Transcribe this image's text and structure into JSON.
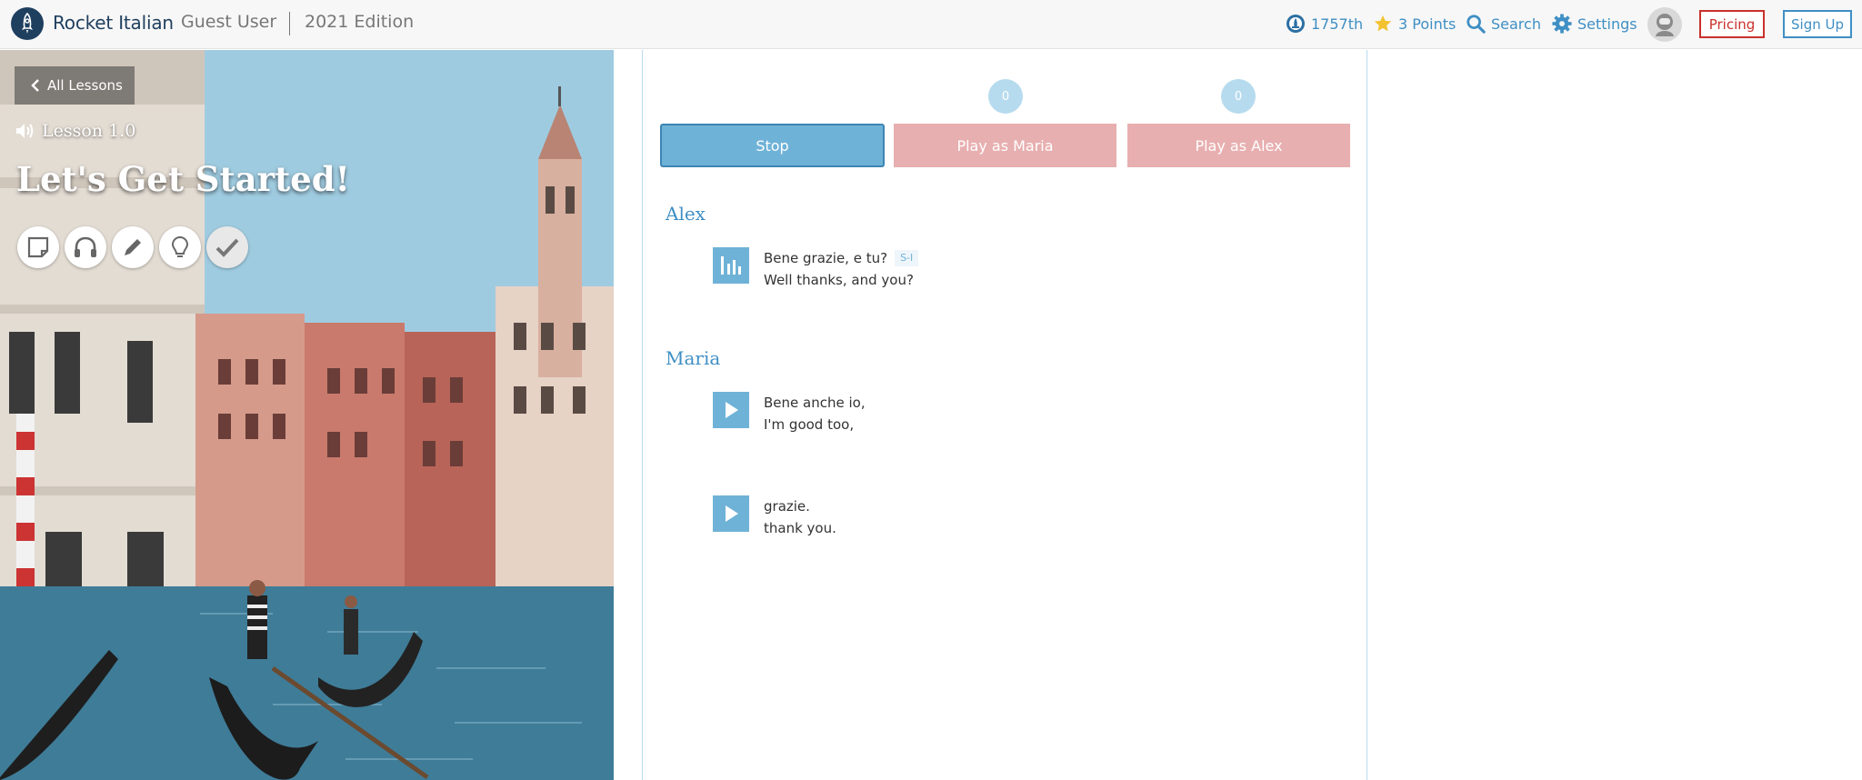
{
  "header": {
    "brand": "Rocket Italian",
    "user": "Guest User",
    "edition": "2021 Edition",
    "rank": "1757th",
    "points": "3 Points",
    "search": "Search",
    "settings": "Settings",
    "pricing": "Pricing",
    "signup": "Sign Up"
  },
  "lesson": {
    "back_label": "All Lessons",
    "number": "Lesson 1.0",
    "title": "Let's Get Started!",
    "tools": [
      {
        "icon": "notepad-icon"
      },
      {
        "icon": "headphones-icon"
      },
      {
        "icon": "pencil-icon"
      },
      {
        "icon": "lightbulb-icon"
      },
      {
        "icon": "checkmark-icon"
      }
    ]
  },
  "player": {
    "maria_count": "0",
    "alex_count": "0",
    "stop_label": "Stop",
    "play_maria_label": "Play as Maria",
    "play_alex_label": "Play as Alex"
  },
  "dialogue": [
    {
      "speaker": "Alex",
      "lines": [
        {
          "italian": "Bene grazie, e tu?",
          "english": "Well thanks, and you?",
          "tag": "S-I",
          "state": "playing"
        }
      ]
    },
    {
      "speaker": "Maria",
      "lines": [
        {
          "italian": "Bene anche io,",
          "english": "I'm good too,",
          "state": "idle"
        },
        {
          "italian": "grazie.",
          "english": "thank you.",
          "state": "idle"
        }
      ]
    }
  ],
  "colors": {
    "accent": "#3f8fc4",
    "play_tile": "#6fb2d7",
    "pink_button": "#e8afb0",
    "pricing_red": "#c9302c"
  }
}
